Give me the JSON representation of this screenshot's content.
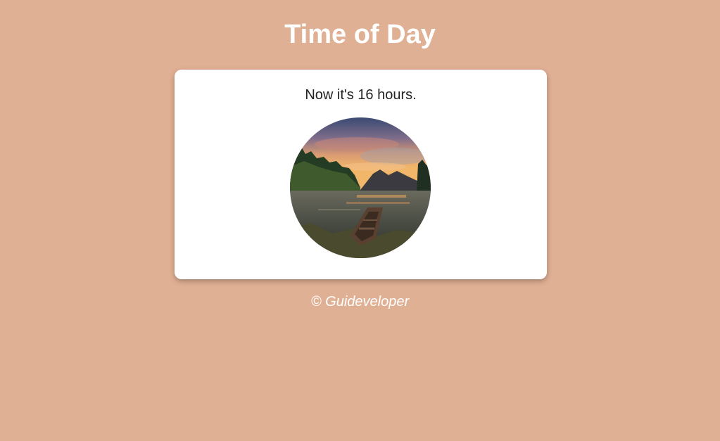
{
  "page": {
    "title": "Time of Day",
    "background_color": "#e0b094"
  },
  "card": {
    "hour_text": "Now it's 16 hours.",
    "image_icon": "sunset-lake-boat-photo"
  },
  "footer": {
    "text": "© Guideveloper"
  }
}
